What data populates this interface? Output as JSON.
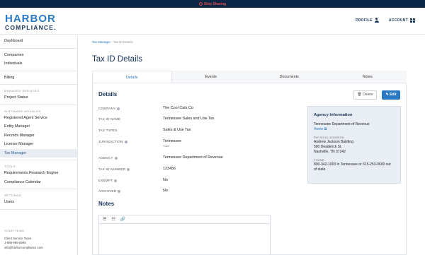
{
  "screenshare": {
    "label": "Stop Sharing"
  },
  "brand": {
    "line1": "HARBOR",
    "line2": "COMPLIANCE."
  },
  "header": {
    "profile": "PROFILE",
    "account": "ACCOUNT"
  },
  "sidebar": {
    "dashboard": "Dashboard",
    "companies": "Companies",
    "individuals": "Individuals",
    "billing": "Billing",
    "managed_services": "MANAGED SERVICES",
    "project_status": "Project Status",
    "software_modules": "SOFTWARE MODULES",
    "registered_agent": "Registered Agent Service",
    "entity_manager": "Entity Manager",
    "records_manager": "Records Manager",
    "license_manager": "License Manager",
    "tax_manager": "Tax Manager",
    "tools": "TOOLS",
    "requirements": "Requirements Research Engine",
    "compliance_calendar": "Compliance Calendar",
    "settings": "SETTINGS",
    "users": "Users",
    "your_team": "YOUR TEAM",
    "team_name": "Client Service Team",
    "team_phone": "1-888-995-5895",
    "team_email": "info@harborcompliance.com"
  },
  "breadcrumb": {
    "parent": "Tax Manager",
    "sep": "›",
    "current": "Tax ID Details"
  },
  "page_title": "Tax ID Details",
  "tabs": [
    "Details",
    "Events",
    "Documents",
    "Notes"
  ],
  "details": {
    "heading": "Details",
    "delete_label": "Delete",
    "edit_label": "Edit",
    "fields": {
      "company_label": "COMPANY",
      "company_value": "The Cool Cats Co",
      "taxid_name_label": "TAX ID NAME",
      "taxid_name_value": "Tennessee Sales and Use Tax",
      "tax_types_label": "TAX TYPES",
      "tax_types_value": "Sales & Use Tax",
      "jurisdiction_label": "JURISDICTION",
      "jurisdiction_value": "Tennessee",
      "jurisdiction_sub": "State",
      "agency_label": "AGENCY",
      "agency_value": "Tennessee Department of Revenue",
      "taxid_number_label": "TAX ID NUMBER",
      "taxid_number_value": "123456",
      "exempt_label": "EXEMPT",
      "exempt_value": "No",
      "archived_label": "ARCHIVED",
      "archived_value": "No"
    }
  },
  "agency_info": {
    "heading": "Agency Information",
    "name": "Tennessee Department of Revenue",
    "home_link": "Home",
    "address_label": "PHYSICAL ADDRESS",
    "address1": "Andrew Jackson Building",
    "address2": "500 Deaderick St.",
    "address3": "Nashville, TN 37242",
    "phone_label": "PHONE",
    "phone": "800-342-1003 in Tennessee or 615-253-0600 out of state"
  },
  "notes": {
    "heading": "Notes"
  }
}
